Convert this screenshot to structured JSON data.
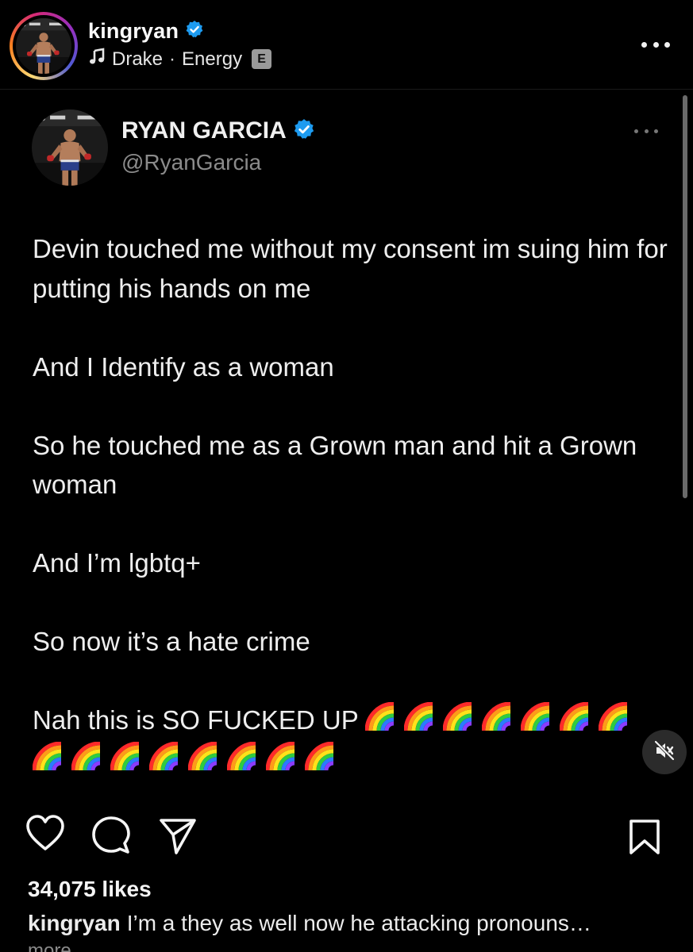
{
  "post": {
    "username": "kingryan",
    "music": {
      "artist": "Drake",
      "separator": "·",
      "song": "Energy",
      "explicit_badge": "E"
    }
  },
  "tweet": {
    "display_name": "RYAN GARCIA",
    "handle": "@RyanGarcia",
    "paragraphs": [
      "Devin touched me without my consent im suing him for putting his hands on me",
      "And I Identify as a woman",
      "So he touched me as a Grown man and hit a Grown woman",
      "And I’m lgbtq+",
      "So now it’s a hate crime"
    ],
    "last_line_text": "Nah this is SO FUCKED UP",
    "rainbow_emoji_count": 15
  },
  "engagement": {
    "likes": "34,075 likes"
  },
  "caption": {
    "username": "kingryan",
    "text": "I’m a they as well now he attacking pronouns…",
    "more": "more"
  },
  "icons": {
    "verified": "verified-badge-icon",
    "music": "music-note-icon",
    "like": "heart-icon",
    "comment": "comment-icon",
    "share": "paper-plane-icon",
    "save": "bookmark-icon",
    "mute": "speaker-muted-icon"
  },
  "colors": {
    "background": "#000000",
    "verified": "#1d9bf0",
    "text": "#f5f5f5",
    "muted_text": "#8b8b8b"
  }
}
